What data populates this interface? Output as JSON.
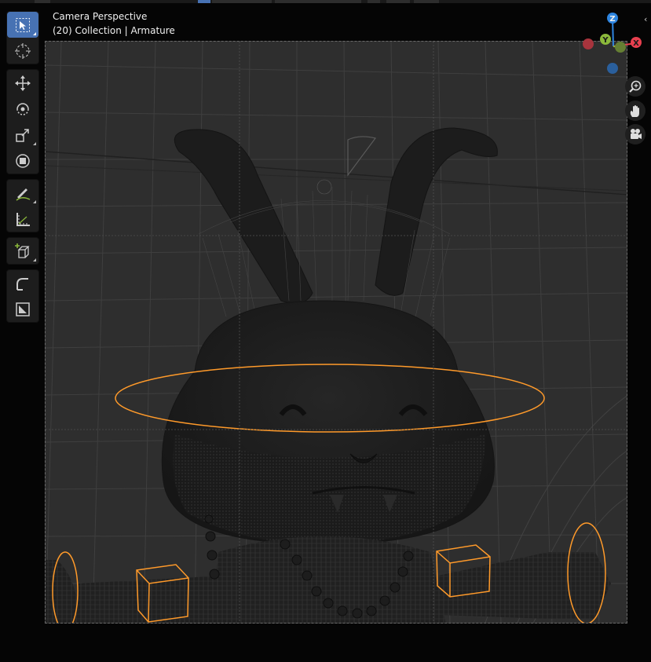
{
  "overlay": {
    "view_name": "Camera Perspective",
    "collection_info": "(20) Collection | Armature"
  },
  "toolbar": {
    "tools": [
      {
        "name": "select-box",
        "icon": "select-box-icon",
        "active": true
      },
      {
        "name": "cursor",
        "icon": "cursor-icon",
        "active": false
      },
      {
        "name": "move",
        "icon": "move-icon",
        "active": false
      },
      {
        "name": "rotate",
        "icon": "rotate-icon",
        "active": false
      },
      {
        "name": "scale",
        "icon": "scale-icon",
        "active": false
      },
      {
        "name": "transform",
        "icon": "transform-icon",
        "active": false
      },
      {
        "name": "annotate",
        "icon": "annotate-icon",
        "active": false
      },
      {
        "name": "measure",
        "icon": "measure-icon",
        "active": false
      },
      {
        "name": "add-cube",
        "icon": "add-cube-icon",
        "active": false
      },
      {
        "name": "extrude",
        "icon": "extrude-icon",
        "active": false
      },
      {
        "name": "inset",
        "icon": "inset-icon",
        "active": false
      }
    ]
  },
  "gizmo": {
    "axes": {
      "x": "X",
      "y": "Y",
      "z": "Z"
    },
    "colors": {
      "x": "#e8404f",
      "y": "#8bb83b",
      "z": "#2e85e0",
      "x_neg": "#a8343d",
      "y_neg": "#657f33",
      "z_neg": "#2a5f9c"
    }
  },
  "nav_buttons": [
    {
      "name": "zoom",
      "icon": "zoom-icon"
    },
    {
      "name": "pan",
      "icon": "hand-icon"
    },
    {
      "name": "camera-view",
      "icon": "camera-icon"
    }
  ],
  "colors": {
    "active_tool": "#4772b3",
    "bone_selection": "#ff9a2a",
    "grid_line": "#3d3d3d",
    "model_fill": "#1e1e1e"
  }
}
